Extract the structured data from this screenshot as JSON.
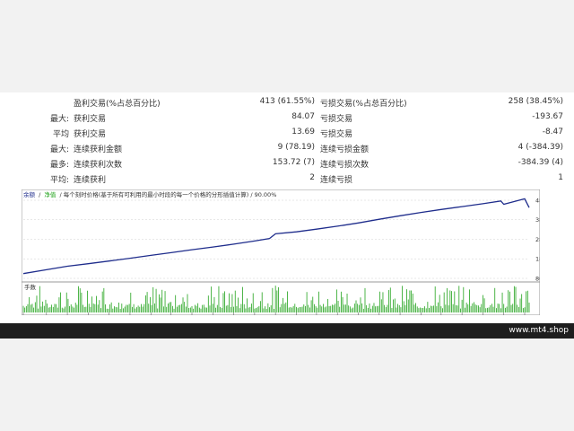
{
  "stats": {
    "rows": [
      {
        "label1": "",
        "label2": "盈利交易(%占总百分比)",
        "val1": "413 (61.55%)",
        "label3": "亏损交易(%占总百分比)",
        "val2": "258 (38.45%)"
      },
      {
        "label1": "最大:",
        "label2": "获利交易",
        "val1": "84.07",
        "label3": "亏损交易",
        "val2": "-193.67"
      },
      {
        "label1": "平均",
        "label2": "获利交易",
        "val1": "13.69",
        "label3": "亏损交易",
        "val2": "-8.47"
      },
      {
        "label1": "最大:",
        "label2": "连续获利金额",
        "val1": "9 (78.19)",
        "label3": "连续亏损金额",
        "val2": "4 (-384.39)"
      },
      {
        "label1": "最多:",
        "label2": "连续获利次数",
        "val1": "153.72 (7)",
        "label3": "连续亏损次数",
        "val2": "-384.39 (4)"
      },
      {
        "label1": "平均:",
        "label2": "连续获利",
        "val1": "2",
        "label3": "连续亏损",
        "val2": "1"
      }
    ]
  },
  "chart": {
    "legend_balance": "余额",
    "legend_sep": "/",
    "legend_equity": "净值",
    "legend_rest": "/ 每个刻时价格(基于所有可利用的最小时段的每一个价格的分形插值计算) / 90.00%",
    "volume_label": "手数",
    "colors": {
      "balance": "#1f2d8c",
      "volume": "#22a31c",
      "grid": "#d0d0d0",
      "text": "#333333"
    }
  },
  "chart_data": {
    "type": "line",
    "x_ticks": [
      "0",
      "31",
      "59",
      "87",
      "115",
      "143",
      "171",
      "198",
      "226",
      "254",
      "282",
      "310",
      "338",
      "366",
      "393",
      "421",
      "449",
      "477",
      "505",
      "533",
      "560",
      "588",
      "616",
      "644",
      "672"
    ],
    "y_ticks": [
      "4828",
      "3823",
      "2818",
      "1813",
      "807"
    ],
    "ylim": [
      807,
      4828
    ],
    "series": [
      {
        "points": [
          [
            0,
            1050
          ],
          [
            31,
            1250
          ],
          [
            59,
            1430
          ],
          [
            87,
            1560
          ],
          [
            115,
            1700
          ],
          [
            143,
            1840
          ],
          [
            171,
            1990
          ],
          [
            198,
            2130
          ],
          [
            226,
            2280
          ],
          [
            254,
            2420
          ],
          [
            282,
            2570
          ],
          [
            310,
            2730
          ],
          [
            330,
            2860
          ],
          [
            338,
            3100
          ],
          [
            366,
            3200
          ],
          [
            393,
            3340
          ],
          [
            421,
            3490
          ],
          [
            449,
            3660
          ],
          [
            477,
            3850
          ],
          [
            505,
            4030
          ],
          [
            533,
            4200
          ],
          [
            560,
            4350
          ],
          [
            588,
            4500
          ],
          [
            616,
            4650
          ],
          [
            640,
            4790
          ],
          [
            644,
            4620
          ],
          [
            672,
            4900
          ],
          [
            678,
            4450
          ]
        ]
      }
    ],
    "volume_x_range": [
      0,
      678
    ]
  },
  "footer": {
    "text": "www.mt4.shop"
  }
}
